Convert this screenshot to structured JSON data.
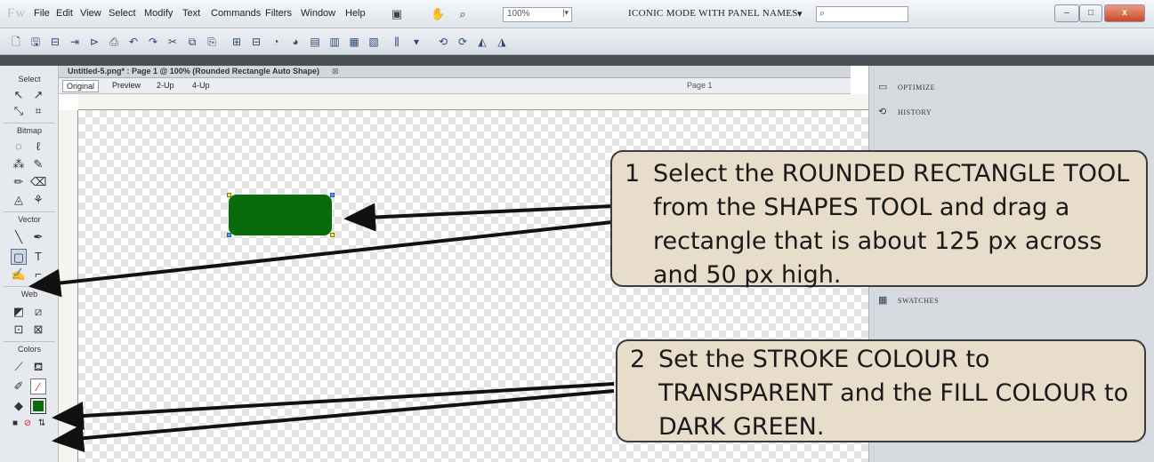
{
  "app": {
    "logo": "Fw"
  },
  "menu": [
    "File",
    "Edit",
    "View",
    "Select",
    "Modify",
    "Text",
    "Commands",
    "Filters",
    "Window",
    "Help"
  ],
  "zoom": {
    "value": "100%"
  },
  "workspace_mode": "ICONIC MODE WITH PANEL NAMES",
  "window_buttons": {
    "minimize": "–",
    "restore": "□",
    "close": "x"
  },
  "document": {
    "tab_title": "Untitled-5.png* : Page 1 @ 100% (Rounded Rectangle Auto Shape)",
    "views": [
      "Original",
      "Preview",
      "2-Up",
      "4-Up"
    ],
    "page": "Page 1"
  },
  "tools_panel": {
    "groups": [
      "Select",
      "Bitmap",
      "Vector",
      "Web",
      "Colors"
    ]
  },
  "right_panel": {
    "items": [
      {
        "label": "OPTIMIZE",
        "icon": "optimize-icon"
      },
      {
        "label": "HISTORY",
        "icon": "history-icon"
      },
      {
        "label": "SWATCHES",
        "icon": "swatches-icon"
      }
    ]
  },
  "shape": {
    "fill": "#0a6b0a"
  },
  "callouts": [
    {
      "num": "1",
      "text": "Select the ROUNDED RECTANGLE TOOL from the SHAPES TOOL and drag a rectangle that is about 125 px across and 50 px high."
    },
    {
      "num": "2",
      "text": "Set the STROKE COLOUR to TRANSPARENT and the FILL COLOUR to DARK GREEN."
    }
  ]
}
